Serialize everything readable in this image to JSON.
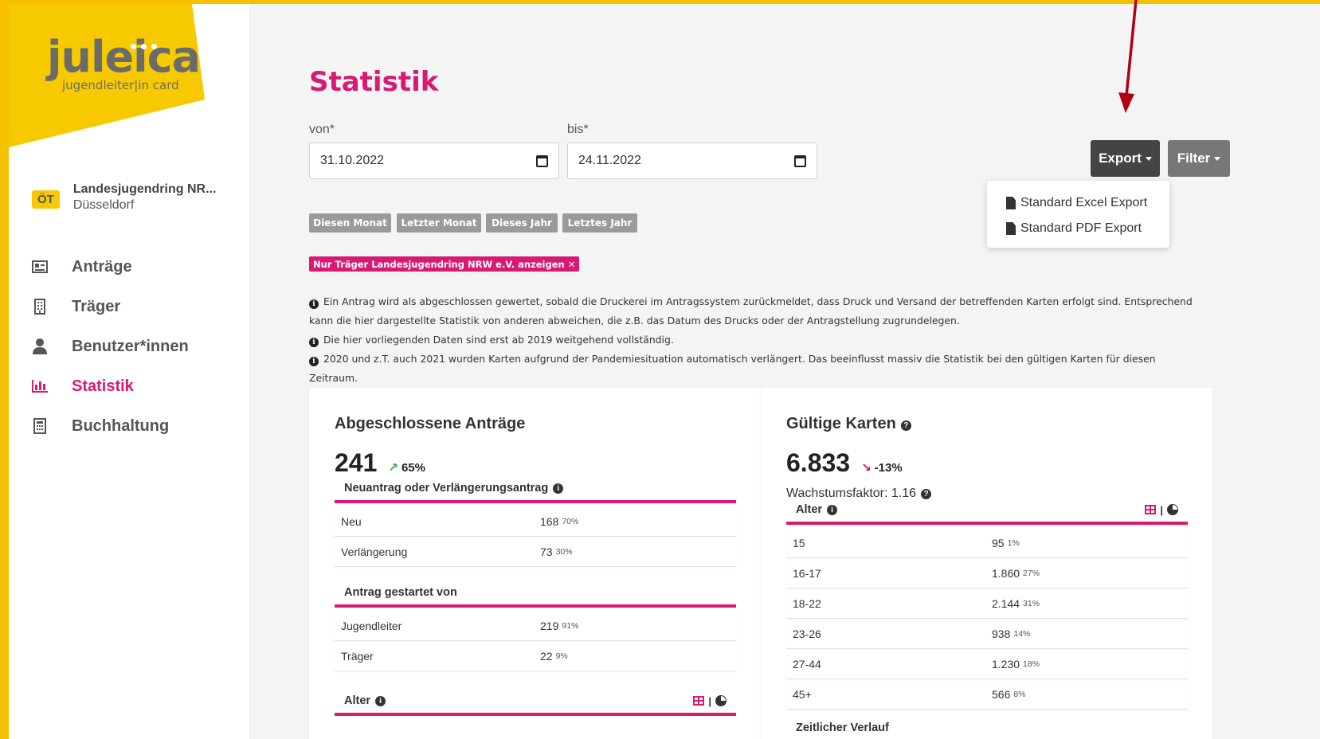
{
  "logo": {
    "name": "juleica",
    "tagline": "jugendleiter|in card"
  },
  "org": {
    "badge": "ÖT",
    "name": "Landesjugendring NR...",
    "city": "Düsseldorf"
  },
  "nav": [
    {
      "label": "Anträge",
      "icon": "id-card-icon"
    },
    {
      "label": "Träger",
      "icon": "building-icon"
    },
    {
      "label": "Benutzer*innen",
      "icon": "user-icon"
    },
    {
      "label": "Statistik",
      "icon": "bar-chart-icon",
      "active": true
    },
    {
      "label": "Buchhaltung",
      "icon": "calculator-icon"
    }
  ],
  "page": {
    "title": "Statistik"
  },
  "dates": {
    "from_label": "von*",
    "from_value": "31.10.2022",
    "to_label": "bis*",
    "to_value": "24.11.2022"
  },
  "buttons": {
    "export": "Export",
    "filter": "Filter"
  },
  "export_menu": [
    "Standard Excel Export",
    "Standard PDF Export"
  ],
  "quick_filters": [
    "Diesen Monat",
    "Letzter Monat",
    "Dieses Jahr",
    "Letztes Jahr"
  ],
  "active_filter": "Nur Träger Landesjugendring NRW e.V. anzeigen ✕",
  "notes": [
    "Ein Antrag wird als abgeschlossen gewertet, sobald die Druckerei im Antragssystem zurückmeldet, dass Druck und Versand der betreffenden Karten erfolgt sind. Entsprechend kann die hier dargestellte Statistik von anderen abweichen, die z.B. das Datum des Drucks oder der Antragstellung zugrundelegen.",
    "Die hier vorliegenden Daten sind erst ab 2019 weitgehend vollständig.",
    "2020 und z.T. auch 2021 wurden Karten aufgrund der Pandemiesituation automatisch verlängert. Das beeinflusst massiv die Statistik bei den gültigen Karten für diesen Zeitraum."
  ],
  "card_left": {
    "title": "Abgeschlossene Anträge",
    "value": "241",
    "trend": "65%",
    "section1": {
      "title": "Neuantrag oder Verlängerungsantrag",
      "rows": [
        {
          "label": "Neu",
          "value": "168",
          "pct": "70%"
        },
        {
          "label": "Verlängerung",
          "value": "73",
          "pct": "30%"
        }
      ]
    },
    "section2": {
      "title": "Antrag gestartet von",
      "rows": [
        {
          "label": "Jugendleiter",
          "value": "219",
          "pct": "91%"
        },
        {
          "label": "Träger",
          "value": "22",
          "pct": "9%"
        }
      ]
    },
    "section3": {
      "title": "Alter"
    }
  },
  "card_right": {
    "title": "Gültige Karten",
    "value": "6.833",
    "trend": "-13%",
    "growth": "Wachstumsfaktor: 1.16",
    "section1": {
      "title": "Alter",
      "rows": [
        {
          "label": "15",
          "value": "95",
          "pct": "1%"
        },
        {
          "label": "16-17",
          "value": "1.860",
          "pct": "27%"
        },
        {
          "label": "18-22",
          "value": "2.144",
          "pct": "31%"
        },
        {
          "label": "23-26",
          "value": "938",
          "pct": "14%"
        },
        {
          "label": "27-44",
          "value": "1.230",
          "pct": "18%"
        },
        {
          "label": "45+",
          "value": "566",
          "pct": "8%"
        }
      ]
    },
    "section2": {
      "title": "Zeitlicher Verlauf"
    }
  },
  "colors": {
    "accent": "#d81a74",
    "brand_yellow": "#f6c900",
    "annotation_arrow": "#b00012"
  }
}
